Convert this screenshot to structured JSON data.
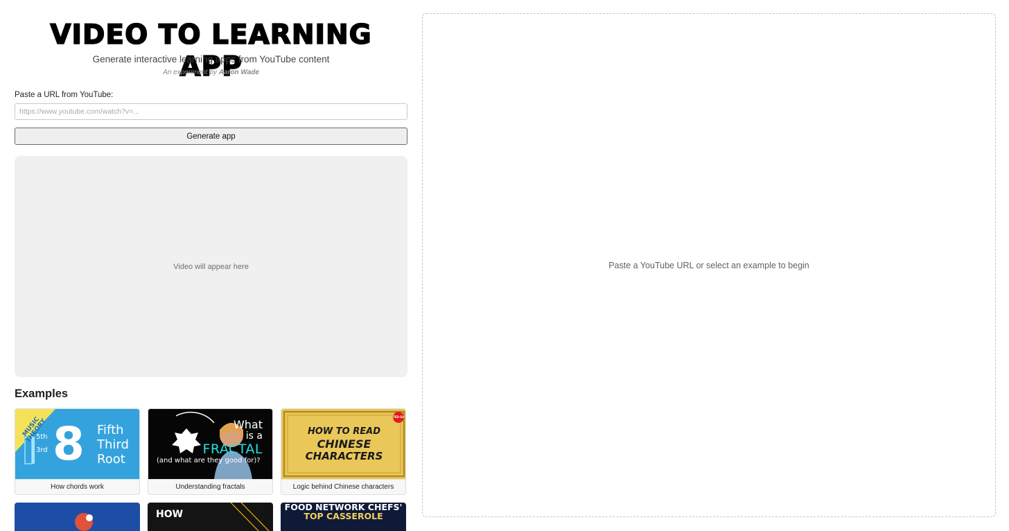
{
  "header": {
    "title": "VIDEO TO LEARNING APP",
    "subtitle": "Generate interactive learning apps from YouTube content",
    "byline_prefix": "An experiment by",
    "byline_author": "Aaron Wade"
  },
  "form": {
    "url_label": "Paste a URL from YouTube:",
    "url_placeholder": "https://www.youtube.com/watch?v=...",
    "url_value": "",
    "generate_label": "Generate app"
  },
  "video": {
    "placeholder": "Video will appear here"
  },
  "examples": {
    "heading": "Examples",
    "items": [
      {
        "caption": "How chords work",
        "thumb": {
          "banner": "MUSIC THEORY",
          "numbers": [
            "5th",
            "3rd",
            "8"
          ],
          "lines": [
            "Fifth",
            "Third",
            "Root"
          ]
        }
      },
      {
        "caption": "Understanding fractals",
        "thumb": {
          "line1": "What",
          "line2": "is a",
          "line3": "FRACTAL",
          "line4": "(and what are they good for)?"
        }
      },
      {
        "caption": "Logic behind Chinese characters",
        "thumb": {
          "badge": "TED-Ed",
          "line1": "HOW TO READ",
          "line2": "CHINESE",
          "line3": "CHARACTERS"
        }
      }
    ],
    "partial": [
      {
        "text": ""
      },
      {
        "text": "HOW"
      },
      {
        "text": "FOOD NETWORK CHEFS'",
        "text2": "TOP CASSEROLE"
      }
    ]
  },
  "output": {
    "placeholder": "Paste a YouTube URL or select an example to begin"
  },
  "colors": {
    "chords_bg": "#34a3dd",
    "chords_banner": "#f4e35a",
    "fractal_accent": "#1ee3e6",
    "chinese_bg": "#e9c759"
  }
}
